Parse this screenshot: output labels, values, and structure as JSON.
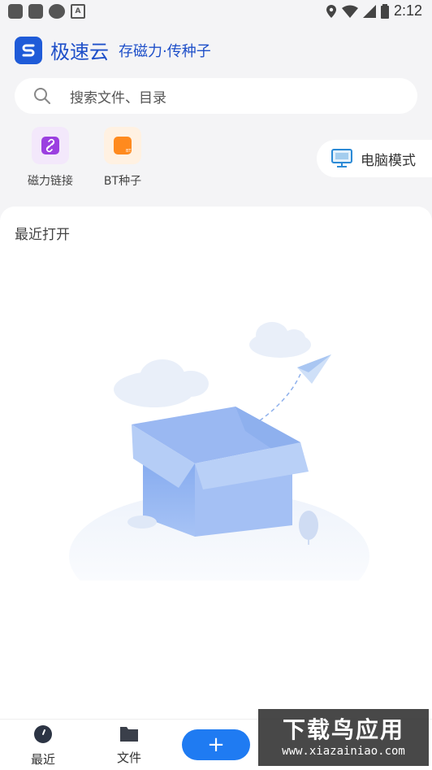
{
  "status_bar": {
    "time": "2:12"
  },
  "brand": {
    "name": "极速云",
    "slogan": "存磁力·传种子"
  },
  "search": {
    "placeholder": "搜索文件、目录"
  },
  "quick_actions": [
    {
      "label": "磁力链接",
      "icon": "link-icon",
      "color": "#9b3fe0"
    },
    {
      "label": "BT种子",
      "icon": "bt-file-icon",
      "color": "#ff8a1e"
    }
  ],
  "pc_mode": {
    "label": "电脑模式",
    "icon": "monitor-icon"
  },
  "section": {
    "title": "最近打开"
  },
  "bottom_nav": {
    "recent": "最近",
    "files": "文件",
    "add_icon": "+"
  },
  "watermark": {
    "main": "下载鸟应用",
    "sub": "www.xiazainiao.com"
  },
  "colors": {
    "brand_blue": "#1e4fc9",
    "accent": "#1f7bf2"
  }
}
